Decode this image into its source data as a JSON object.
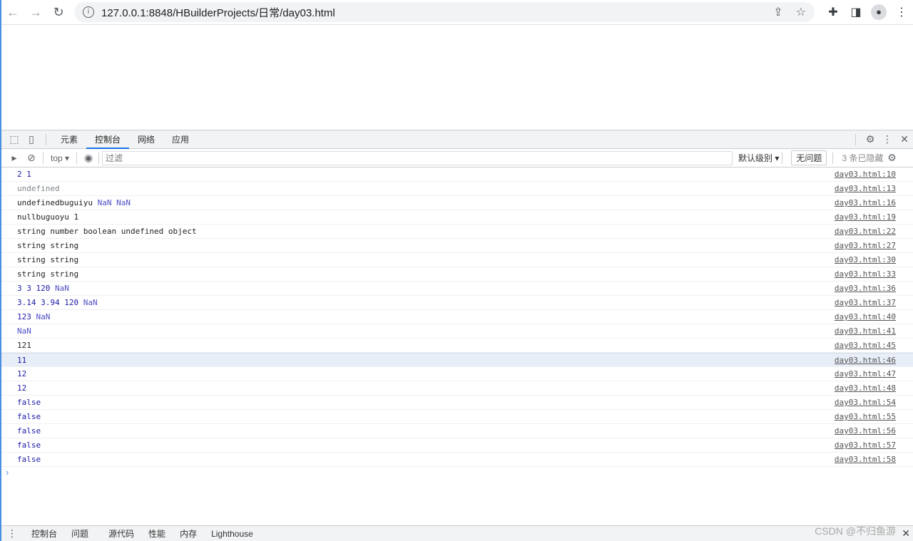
{
  "browser": {
    "url": "127.0.0.1:8848/HBuilderProjects/日常/day03.html"
  },
  "devtools": {
    "tabs": [
      "元素",
      "控制台",
      "网络",
      "应用"
    ],
    "active_tab": 1,
    "context": "top",
    "filter_placeholder": "过滤",
    "level": "默认级别",
    "issues": "无问题",
    "hidden": "3 条已隐藏"
  },
  "console": [
    {
      "parts": [
        {
          "t": "2 1",
          "c": "num"
        }
      ],
      "src": "day03.html:10"
    },
    {
      "parts": [
        {
          "t": "undefined",
          "c": "undef"
        }
      ],
      "src": "day03.html:13"
    },
    {
      "parts": [
        {
          "t": "undefinedbuguiyu ",
          "c": "str"
        },
        {
          "t": "NaN NaN",
          "c": "nan"
        }
      ],
      "src": "day03.html:16"
    },
    {
      "parts": [
        {
          "t": "nullbuguoyu 1",
          "c": "str"
        }
      ],
      "src": "day03.html:19"
    },
    {
      "parts": [
        {
          "t": "string number boolean undefined object",
          "c": "str"
        }
      ],
      "src": "day03.html:22"
    },
    {
      "parts": [
        {
          "t": "string string",
          "c": "str"
        }
      ],
      "src": "day03.html:27"
    },
    {
      "parts": [
        {
          "t": "string string",
          "c": "str"
        }
      ],
      "src": "day03.html:30"
    },
    {
      "parts": [
        {
          "t": "string string",
          "c": "str"
        }
      ],
      "src": "day03.html:33"
    },
    {
      "parts": [
        {
          "t": "3 3 120 ",
          "c": "num"
        },
        {
          "t": "NaN",
          "c": "nan"
        }
      ],
      "src": "day03.html:36"
    },
    {
      "parts": [
        {
          "t": "3.14 3.94 120 ",
          "c": "num"
        },
        {
          "t": "NaN",
          "c": "nan"
        }
      ],
      "src": "day03.html:37"
    },
    {
      "parts": [
        {
          "t": "123 ",
          "c": "num"
        },
        {
          "t": "NaN",
          "c": "nan"
        }
      ],
      "src": "day03.html:40"
    },
    {
      "parts": [
        {
          "t": "NaN",
          "c": "nan"
        }
      ],
      "src": "day03.html:41"
    },
    {
      "parts": [
        {
          "t": "121",
          "c": "str"
        }
      ],
      "src": "day03.html:45"
    },
    {
      "parts": [
        {
          "t": "11",
          "c": "num"
        }
      ],
      "src": "day03.html:46",
      "highlight": true
    },
    {
      "parts": [
        {
          "t": "12",
          "c": "num"
        }
      ],
      "src": "day03.html:47"
    },
    {
      "parts": [
        {
          "t": "12",
          "c": "num"
        }
      ],
      "src": "day03.html:48"
    },
    {
      "parts": [
        {
          "t": "false",
          "c": "bool"
        }
      ],
      "src": "day03.html:54"
    },
    {
      "parts": [
        {
          "t": "false",
          "c": "bool"
        }
      ],
      "src": "day03.html:55"
    },
    {
      "parts": [
        {
          "t": "false",
          "c": "bool"
        }
      ],
      "src": "day03.html:56"
    },
    {
      "parts": [
        {
          "t": "false",
          "c": "bool"
        }
      ],
      "src": "day03.html:57"
    },
    {
      "parts": [
        {
          "t": "false",
          "c": "bool"
        }
      ],
      "src": "day03.html:58"
    }
  ],
  "drawer": {
    "tabs": [
      "控制台",
      "问题",
      "源代码",
      "性能",
      "内存",
      "Lighthouse"
    ]
  },
  "watermark": "CSDN @不归鱼游"
}
